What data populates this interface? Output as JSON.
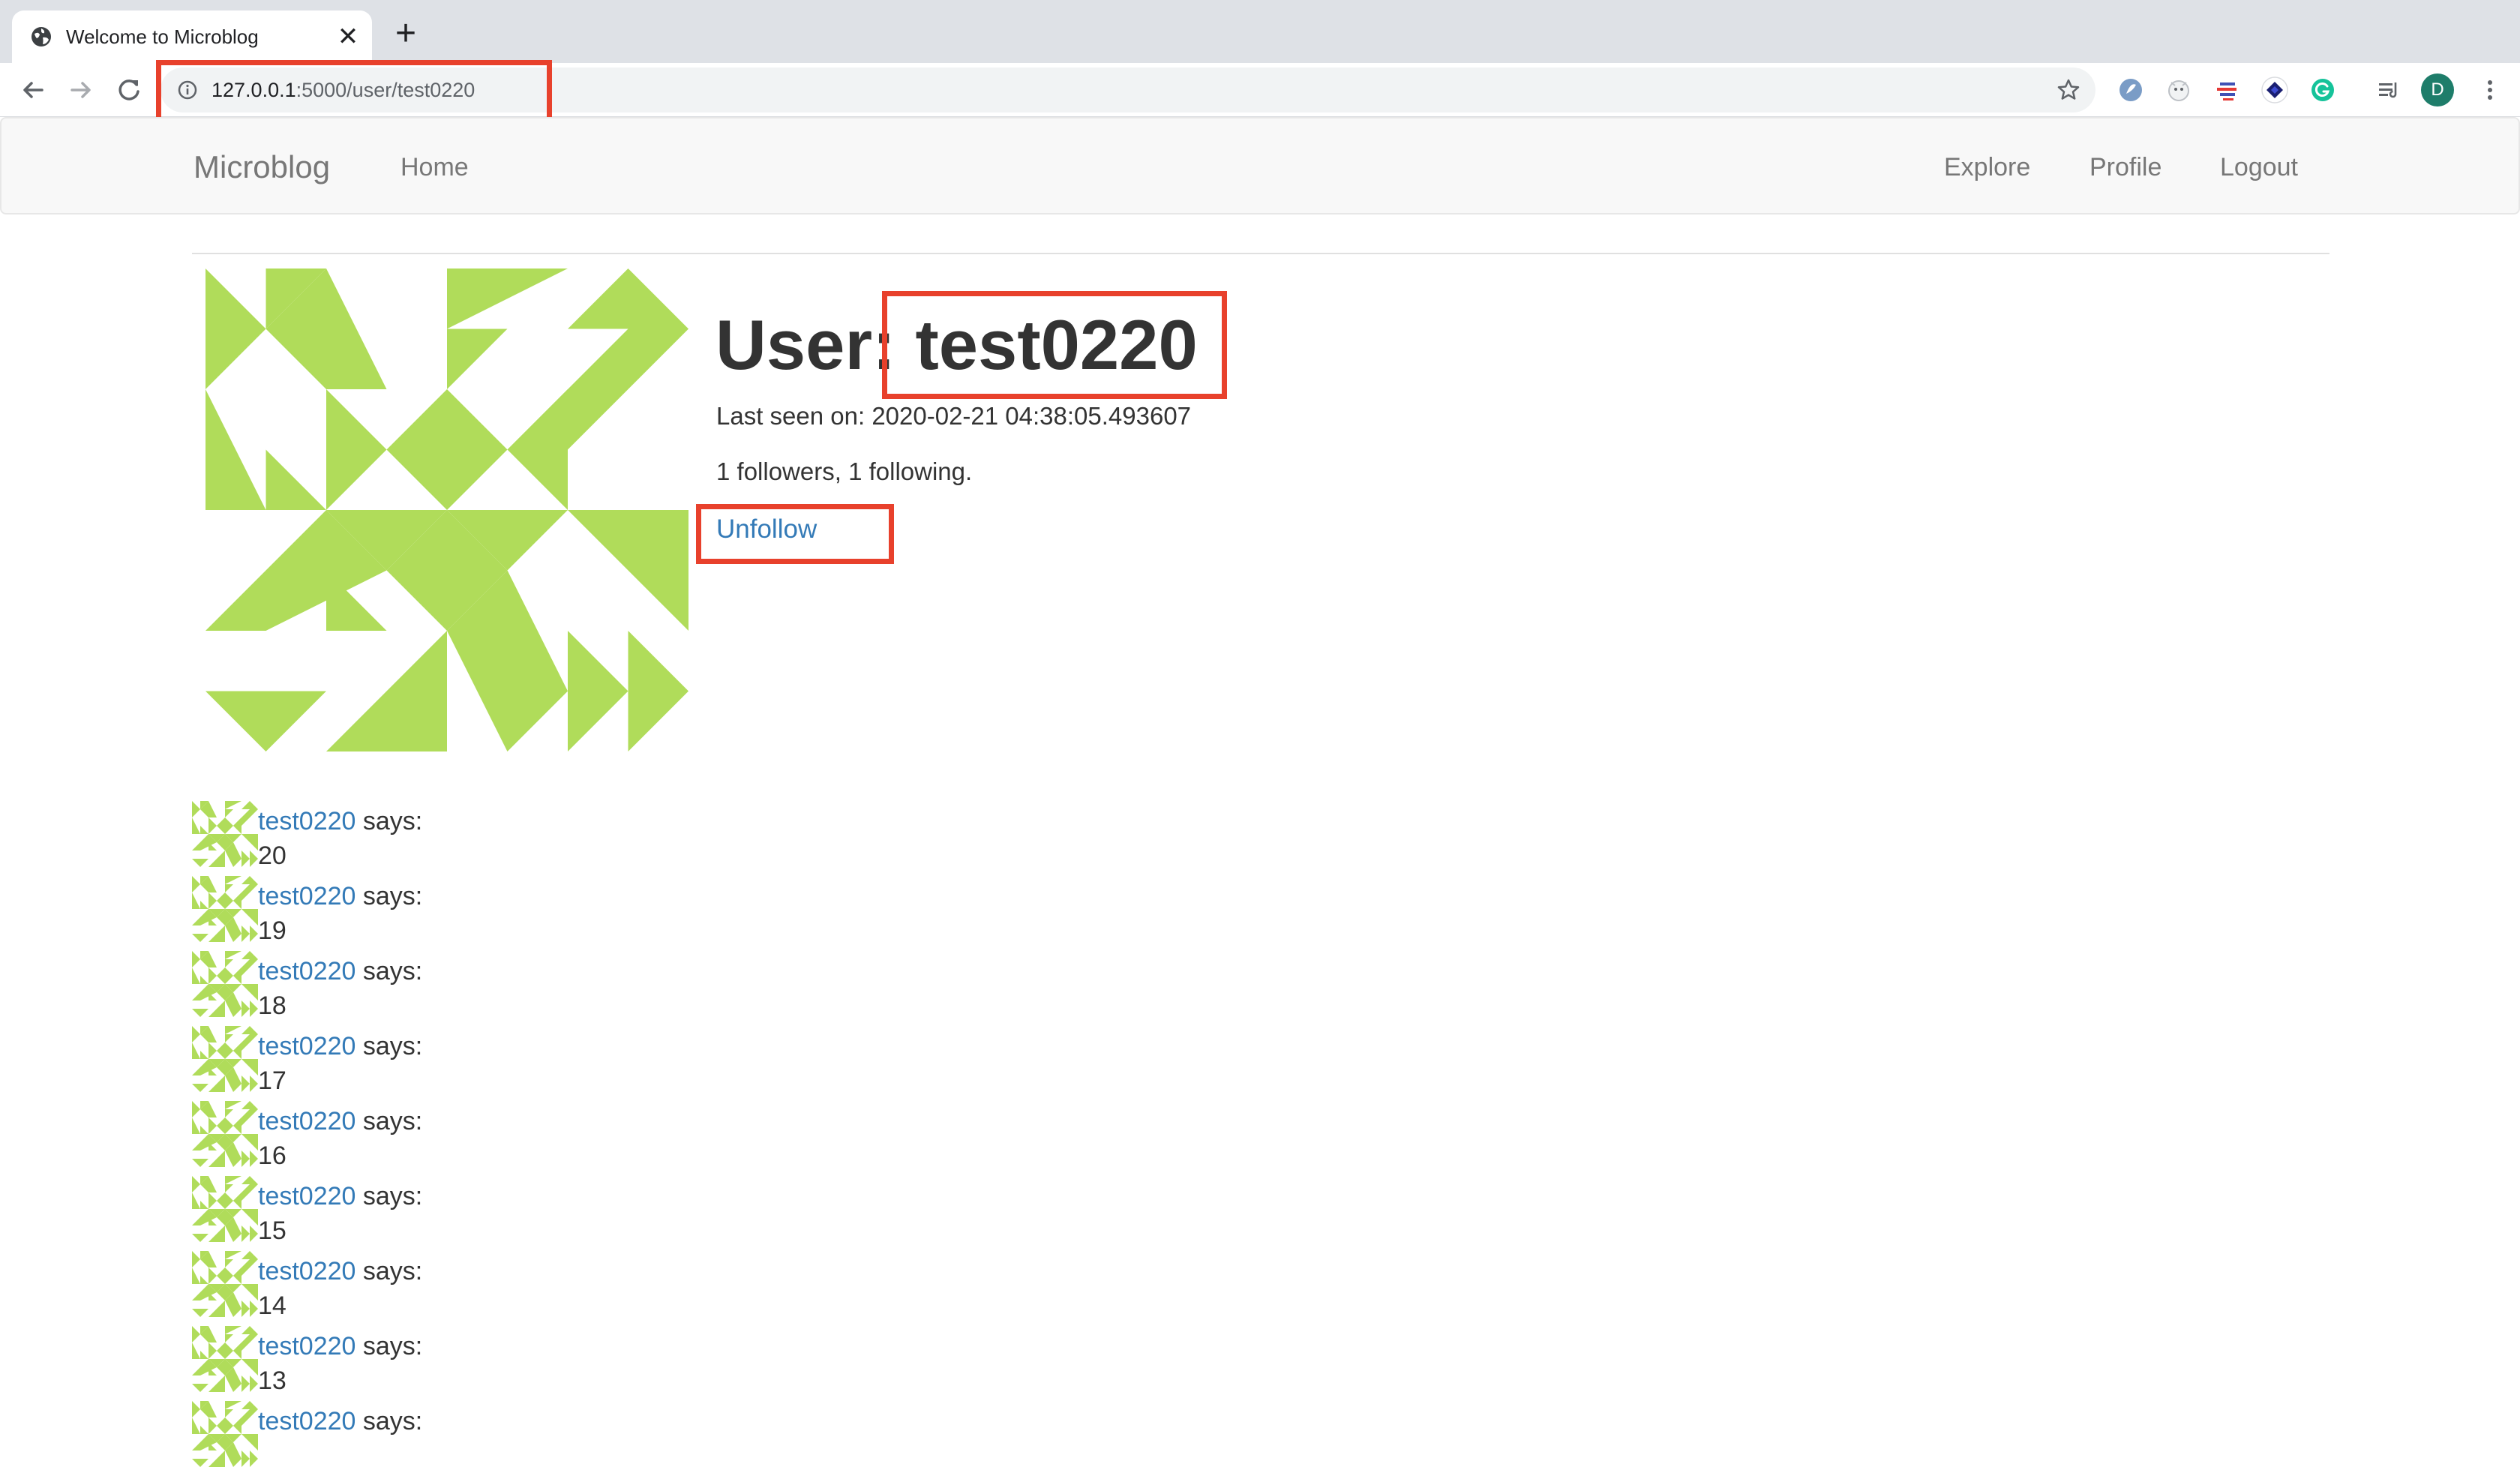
{
  "browser": {
    "tab_title": "Welcome to Microblog",
    "close_glyph": "✕",
    "new_tab_glyph": "+",
    "url_host": "127.0.0.1",
    "url_path": ":5000/user/test0220",
    "profile_initial": "D"
  },
  "navbar": {
    "brand": "Microblog",
    "home": "Home",
    "explore": "Explore",
    "profile": "Profile",
    "logout": "Logout"
  },
  "user": {
    "heading_prefix": "User: ",
    "username": "test0220",
    "last_seen": "Last seen on: 2020-02-21 04:38:05.493607",
    "follow_counts": "1 followers, 1 following.",
    "unfollow": "Unfollow"
  },
  "posts": [
    {
      "author": "test0220",
      "says": " says:",
      "body": "20"
    },
    {
      "author": "test0220",
      "says": " says:",
      "body": "19"
    },
    {
      "author": "test0220",
      "says": " says:",
      "body": "18"
    },
    {
      "author": "test0220",
      "says": " says:",
      "body": "17"
    },
    {
      "author": "test0220",
      "says": " says:",
      "body": "16"
    },
    {
      "author": "test0220",
      "says": " says:",
      "body": "15"
    },
    {
      "author": "test0220",
      "says": " says:",
      "body": "14"
    },
    {
      "author": "test0220",
      "says": " says:",
      "body": "13"
    },
    {
      "author": "test0220",
      "says": " says:",
      "body": ""
    }
  ],
  "colors": {
    "avatar_green": "#b0dc5a",
    "link_blue": "#337ab7",
    "highlight_red": "#e8412c"
  },
  "icons": {
    "tab_favicon": "globe-icon",
    "back": "back-arrow-icon",
    "forward": "forward-arrow-icon",
    "reload": "reload-icon",
    "info": "info-icon",
    "bookmark": "star-icon",
    "menu": "vertical-dots-icon"
  }
}
